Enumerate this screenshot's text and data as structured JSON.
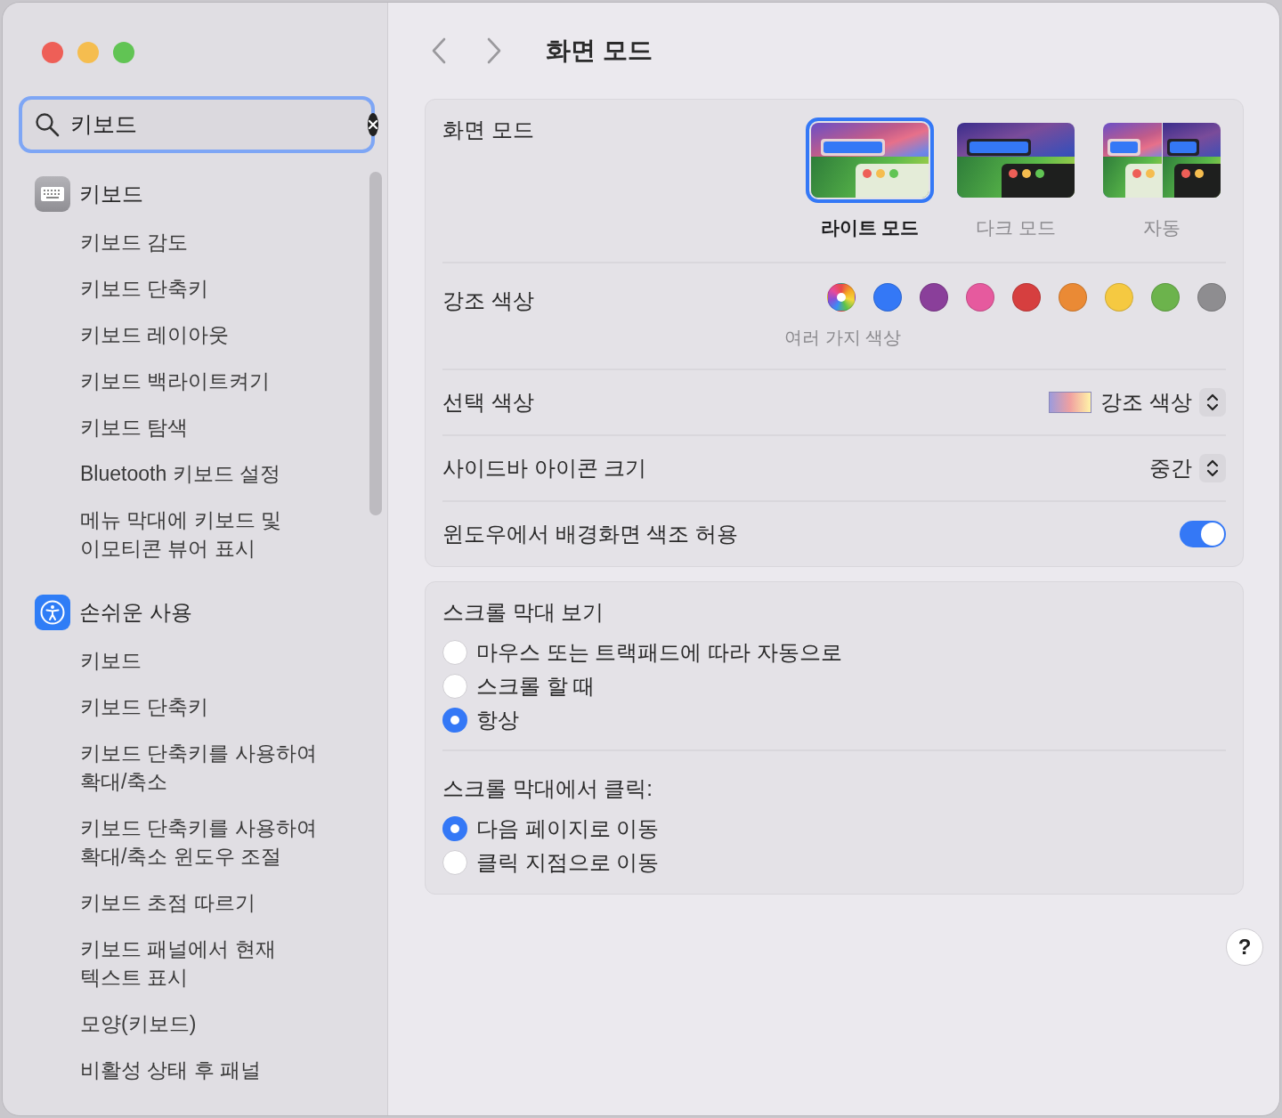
{
  "search": {
    "value": "키보드"
  },
  "sidebar": {
    "groups": [
      {
        "label": "키보드",
        "kind": "keyboard",
        "children": [
          "키보드 감도",
          "키보드 단축키",
          "키보드 레이아웃",
          "키보드 백라이트켜기",
          "키보드 탐색",
          "Bluetooth 키보드 설정",
          "메뉴 막대에 키보드 및 이모티콘 뷰어 표시"
        ]
      },
      {
        "label": "손쉬운 사용",
        "kind": "accessibility",
        "children": [
          "키보드",
          "키보드 단축키",
          "키보드 단축키를 사용하여 확대/축소",
          "키보드 단축키를 사용하여 확대/축소 윈도우 조절",
          "키보드 초점 따르기",
          "키보드 패널에서 현재 텍스트 표시",
          "모양(키보드)",
          "비활성 상태 후 패널"
        ]
      }
    ]
  },
  "toolbar": {
    "title": "화면 모드"
  },
  "appearance": {
    "label": "화면 모드",
    "options": [
      {
        "label": "라이트 모드",
        "kind": "light",
        "selected": true
      },
      {
        "label": "다크 모드",
        "kind": "dark",
        "selected": false
      },
      {
        "label": "자동",
        "kind": "auto",
        "selected": false
      }
    ]
  },
  "accent": {
    "label": "강조 색상",
    "caption": "여러 가지 색상",
    "colors": [
      {
        "kind": "multicolor",
        "color": "#ffffff",
        "selected": true
      },
      {
        "kind": "solid",
        "color": "#3478f6",
        "selected": false
      },
      {
        "kind": "solid",
        "color": "#8a3f9a",
        "selected": false
      },
      {
        "kind": "solid",
        "color": "#e65a9e",
        "selected": false
      },
      {
        "kind": "solid",
        "color": "#d63f3f",
        "selected": false
      },
      {
        "kind": "solid",
        "color": "#ea8a35",
        "selected": false
      },
      {
        "kind": "solid",
        "color": "#f5c941",
        "selected": false
      },
      {
        "kind": "solid",
        "color": "#6cb34c",
        "selected": false
      },
      {
        "kind": "solid",
        "color": "#8e8d90",
        "selected": false
      }
    ]
  },
  "highlight": {
    "label": "선택 색상",
    "value": "강조 색상"
  },
  "sidebar_icon_size": {
    "label": "사이드바 아이콘 크기",
    "value": "중간"
  },
  "wallpaper_tinting": {
    "label": "윈도우에서 배경화면 색조 허용",
    "on": true
  },
  "scroll": {
    "groups": [
      {
        "title": "스크롤 막대 보기",
        "options": [
          {
            "label": "마우스 또는 트랙패드에 따라 자동으로",
            "selected": false
          },
          {
            "label": "스크롤 할 때",
            "selected": false
          },
          {
            "label": "항상",
            "selected": true
          }
        ]
      },
      {
        "title": "스크롤 막대에서 클릭:",
        "options": [
          {
            "label": "다음 페이지로 이동",
            "selected": true
          },
          {
            "label": "클릭 지점으로 이동",
            "selected": false
          }
        ]
      }
    ]
  },
  "help": {
    "label": "?"
  }
}
